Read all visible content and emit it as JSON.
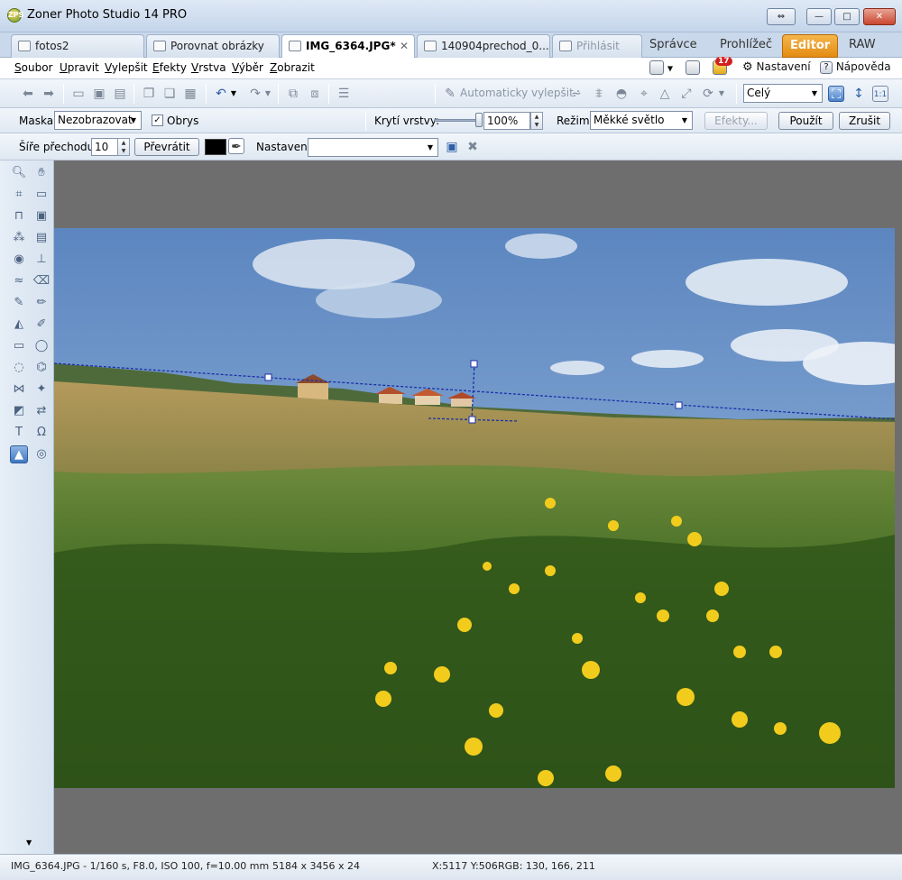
{
  "window": {
    "title": "Zoner Photo Studio 14 PRO",
    "app_icon": "ZPS"
  },
  "window_controls": {
    "restore_label": "⇔",
    "minimize_label": "—",
    "maximize_label": "□",
    "close_label": "✕"
  },
  "tabs": [
    {
      "label": "fotos2",
      "icon": "folder-icon",
      "active": false
    },
    {
      "label": "Porovnat obrázky",
      "icon": "compare-icon",
      "active": false
    },
    {
      "label": "IMG_6364.JPG*",
      "icon": "edit-icon",
      "active": true
    },
    {
      "label": "140904prechod_0...",
      "icon": "edit-icon",
      "active": false
    },
    {
      "label": "Přihlásit",
      "icon": "login-icon",
      "active": false
    }
  ],
  "modes": [
    "Správce",
    "Prohlížeč",
    "Editor",
    "RAW"
  ],
  "active_mode": "Editor",
  "menu": [
    "Soubor",
    "Upravit",
    "Vylepšit",
    "Efekty",
    "Vrstva",
    "Výběr",
    "Zobrazit"
  ],
  "menu_right": {
    "notifications_count": "17",
    "settings": "Nastavení",
    "help": "Nápověda"
  },
  "toolbar": {
    "auto_enhance": "Automaticky vylepšit",
    "zoom_select": "Celý",
    "zoom_11": "1:1"
  },
  "options": {
    "mask_label": "Maska:",
    "mask_value": "Nezobrazovat",
    "outline_label": "Obrys",
    "outline_checked": "✓",
    "opacity_label": "Krytí vrstvy:",
    "opacity_value": "100%",
    "opacity_level": 1.0,
    "mode_label": "Režim:",
    "mode_value": "Měkké světlo",
    "effects_button": "Efekty...",
    "apply_button": "Použít",
    "cancel_button": "Zrušit"
  },
  "gradient": {
    "width_label": "Šíře přechodu:",
    "width_value": "10",
    "invert_button": "Převrátit",
    "color": "#000000",
    "settings_label": "Nastavení:",
    "settings_value": ""
  },
  "status": {
    "file_info": "IMG_6364.JPG - 1/160 s, F8.0, ISO 100, f=10.00 mm",
    "dimensions": "5184 x 3456 x 24",
    "position": "X:5117 Y:506",
    "rgb": "RGB: 130, 166, 211"
  },
  "colors": {
    "accent": "#e38c12",
    "sky": "#7ea6d3",
    "grass": "#3f6a22",
    "canvas_bg": "#6e6e6e"
  }
}
